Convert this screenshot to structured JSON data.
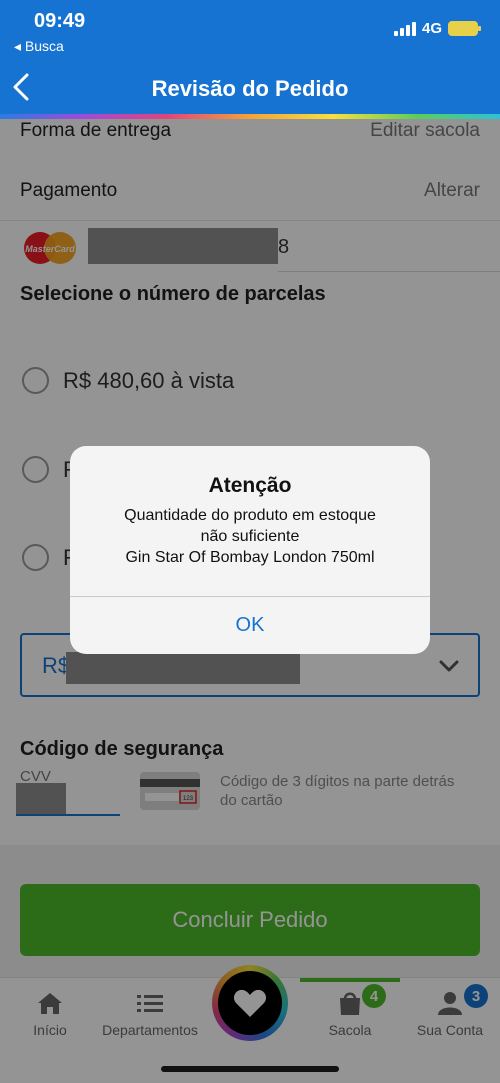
{
  "status_bar": {
    "time": "09:49",
    "back_label": "◂ Busca",
    "network": "4G"
  },
  "header": {
    "title": "Revisão do Pedido"
  },
  "delivery": {
    "label": "Forma de entrega",
    "action": "Editar sacola"
  },
  "payment": {
    "label": "Pagamento",
    "action": "Alterar",
    "card_brand": "MasterCard",
    "card_last_digit": "8"
  },
  "installments": {
    "title": "Selecione o número de parcelas",
    "options": [
      "R$ 480,60 à vista",
      "R",
      "R"
    ],
    "select_prefix": "R$"
  },
  "security": {
    "title": "Código de segurança",
    "cvv_label": "CVV",
    "hint": "Código de 3 dígitos na parte detrás do cartão",
    "card_code": "123"
  },
  "checkout": {
    "button_label": "Concluir Pedido"
  },
  "tabbar": {
    "items": [
      {
        "label": "Início"
      },
      {
        "label": "Departamentos"
      },
      {
        "label": "Sacola",
        "badge": "4"
      },
      {
        "label": "Sua Conta",
        "badge": "3"
      }
    ]
  },
  "dialog": {
    "title": "Atenção",
    "line1": "Quantidade do produto em estoque",
    "line2": "não suficiente",
    "line3": "Gin Star Of Bombay London 750ml",
    "ok_label": "OK"
  },
  "colors": {
    "primary": "#1773d1",
    "cta": "#4dbb2c",
    "badge_green": "#4dbb2c",
    "badge_blue": "#1773d1"
  }
}
